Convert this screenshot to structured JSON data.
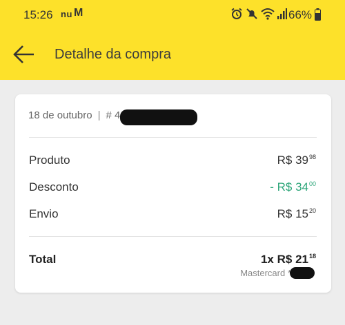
{
  "status_bar": {
    "time": "15:26",
    "app_logo": "nu",
    "mail_icon": "M",
    "icons": [
      "alarm-icon",
      "mute-icon",
      "wifi-icon",
      "signal-icon"
    ],
    "battery": "66%"
  },
  "header": {
    "title": "Detalhe da compra",
    "back_icon": "arrow-left-icon"
  },
  "order": {
    "date": "18 de outubro",
    "separator": "|",
    "number_prefix": "# 4"
  },
  "rows": [
    {
      "label": "Produto",
      "currency": "R$ ",
      "amount": "39",
      "cents": "98"
    },
    {
      "label": "Desconto",
      "currency": "- R$ ",
      "amount": "34",
      "cents": "00"
    },
    {
      "label": "Envio",
      "currency": "R$ ",
      "amount": "15",
      "cents": "20"
    }
  ],
  "total": {
    "label": "Total",
    "qty_currency": "1x R$ ",
    "amount": "21",
    "cents": "18",
    "payment": "Mastercard ***"
  },
  "colors": {
    "header_bg": "#fde12a",
    "discount": "#2ea67a"
  }
}
